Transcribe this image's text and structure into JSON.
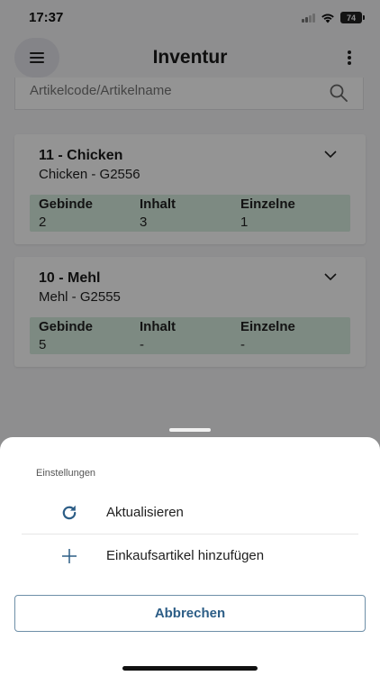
{
  "status_bar": {
    "time": "17:37",
    "battery": "74"
  },
  "header": {
    "title": "Inventur",
    "menu_icon": "hamburger-icon",
    "more_icon": "more-vertical-icon"
  },
  "search": {
    "placeholder": "Artikelcode/Artikelname",
    "icon": "search-icon"
  },
  "items": [
    {
      "title": "11 - Chicken",
      "subtitle": "Chicken - G2556",
      "gebinde": "2",
      "inhalt": "3",
      "einzelne": "1"
    },
    {
      "title": "10 - Mehl",
      "subtitle": "Mehl - G2555",
      "gebinde": "5",
      "inhalt": "-",
      "einzelne": "-"
    }
  ],
  "columns": {
    "gebinde": "Gebinde",
    "inhalt": "Inhalt",
    "einzelne": "Einzelne"
  },
  "sheet": {
    "title": "Einstellungen",
    "actions": [
      {
        "label": "Aktualisieren",
        "icon": "refresh-icon"
      },
      {
        "label": "Einkaufsartikel hinzufügen",
        "icon": "plus-icon"
      }
    ],
    "cancel_label": "Abbrechen"
  },
  "colors": {
    "accent": "#2c5d86",
    "quantity_bg": "#d8eee0"
  }
}
